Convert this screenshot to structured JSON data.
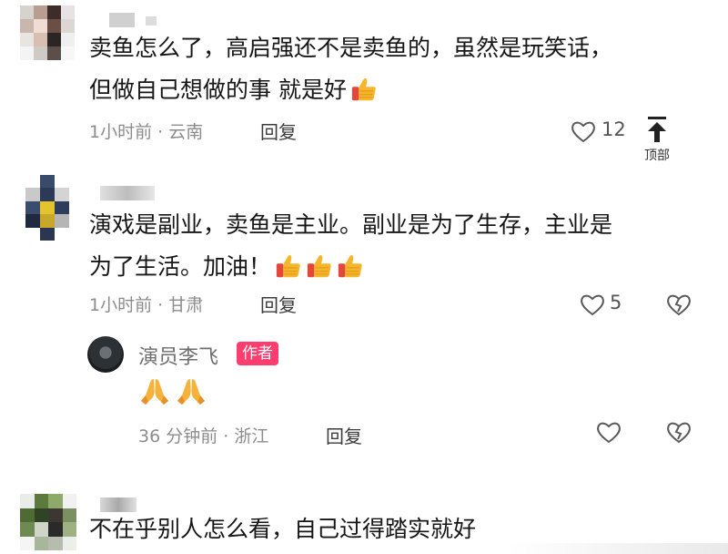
{
  "comments": [
    {
      "text_line1": "卖鱼怎么了，高启强还不是卖鱼的，虽然是玩笑话，",
      "text_line2": "但做自己想做的事 就是好",
      "meta": "1小时前 · 云南",
      "reply_label": "回复",
      "likes": "12",
      "emoji": "thumbs-up"
    },
    {
      "text_line1": "演戏是副业，卖鱼是主业。副业是为了生存，主业是",
      "text_line2": "为了生活。加油！",
      "meta": "1小时前 · 甘肃",
      "reply_label": "回复",
      "likes": "5",
      "emoji": "thumbs-up x3"
    },
    {
      "author": "演员李飞",
      "badge": "作者",
      "emoji": "folded-hands x2",
      "meta": "36 分钟前 · 浙江",
      "reply_label": "回复"
    },
    {
      "text_line1": "不在乎别人怎么看，自己过得踏实就好"
    }
  ],
  "top_button": {
    "label": "顶部",
    "icon": "arrow-up-icon"
  },
  "colors": {
    "badge": "#ff3d6e",
    "meta_gray": "#8c8c8c",
    "thumb": "#f5a623"
  }
}
